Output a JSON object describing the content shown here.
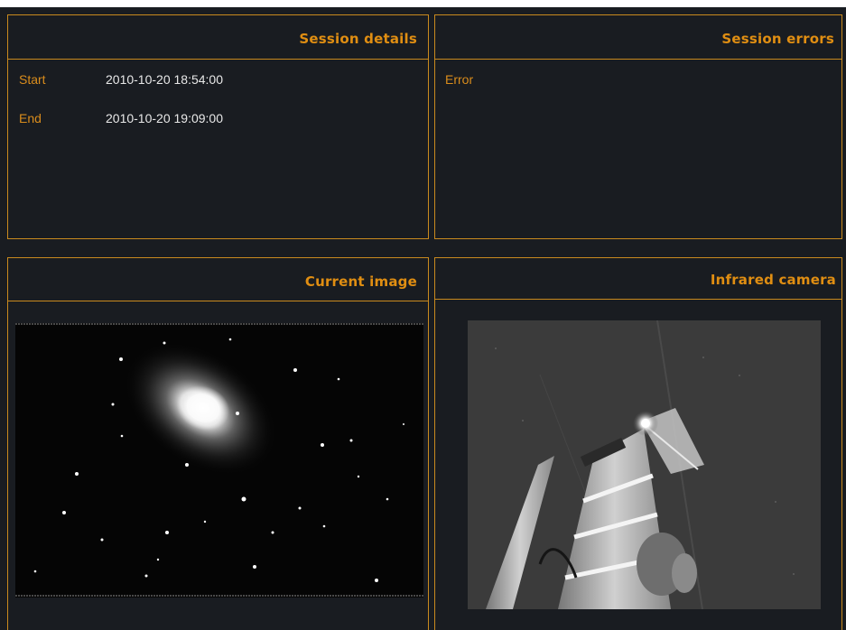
{
  "panels": {
    "session_details": {
      "title": "Session details",
      "start_label": "Start",
      "start_value": "2010-10-20 18:54:00",
      "end_label": "End",
      "end_value": "2010-10-20 19:09:00"
    },
    "session_errors": {
      "title": "Session errors",
      "error_label": "Error"
    },
    "current_image": {
      "title": "Current image"
    },
    "infrared_camera": {
      "title": "Infrared camera"
    }
  },
  "colors": {
    "background": "#191c21",
    "accent": "#e08e12",
    "border": "#c98a1e",
    "value_text": "#e8e8e8"
  }
}
